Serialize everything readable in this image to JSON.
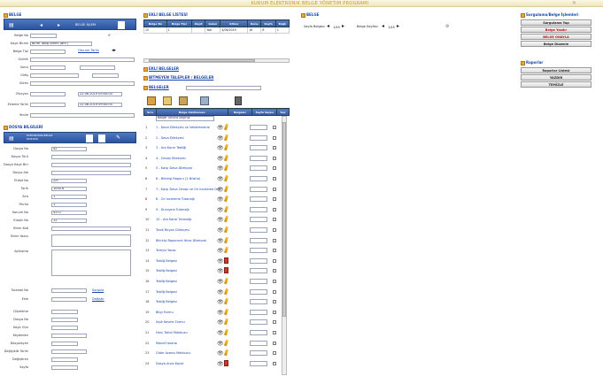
{
  "title": "KURUM ELEKTRONIK BELGE YÖNETIM PROGRAMI",
  "belge": {
    "head": "BELGE",
    "btn_belge": "BELGE İŞLEM",
    "labels": [
      "Belge No",
      "Kayıt Birimi",
      "Belge Tipi",
      "Gizlilik",
      "Konu",
      "Gidiş",
      "Sürev",
      "Ekleyen",
      "Ekleme Tarihi"
    ],
    "values": [
      "",
      "Birim Takip Birimi (BRT)",
      "",
      "",
      "Oturum Tarihi",
      "",
      "",
      "",
      ""
    ],
    "kayit_tarihi": "22.06.2019 09:00:00",
    "gelis_tarihi": "22.06.2019 09:00:00",
    "yenile": "Yenile"
  },
  "ekli": {
    "head": "EKLİ BELGE LİSTESİ",
    "cols": [
      "Belge No",
      "Belge Tipi",
      "Kayıt",
      "Gelen",
      "Gitme",
      "Konu",
      "Sayfa",
      "Bağlı"
    ],
    "row": [
      "15",
      "1",
      "",
      "Yazı",
      "4/06/2019",
      "16",
      "8",
      "1"
    ]
  },
  "links": {
    "ekli_belgeler": "EKLİ BELGELER",
    "ilgili": "BİTMEYEN TALEPLER / BELGELER",
    "belgeler": "BELGELER"
  },
  "dosya": {
    "head": "DOSYA BİLGİLERİ",
    "btn": "ELEKTRONIK BELGE DOSYASI",
    "labels": [
      "Dosya No",
      "Dosya Türü",
      "Dosya Kayıt Birimi",
      "Dosya Adı",
      "Etiket No",
      "Tarih",
      "Sıra",
      "Fihrist",
      "Konum No",
      "Klasör No",
      "Birim Kod",
      "Birim Yazısı",
      "Açıklama",
      "Tutanak No",
      "Ekle",
      "Düzeltme",
      "Dosya No",
      "Kayıt Gün",
      "Kaydeden",
      "Dosyalayan",
      "Değişiklik Tarihi",
      "Değiştiren",
      "Sayfa"
    ],
    "vals": [
      "42",
      "",
      "",
      "",
      "2/9",
      "1000.8",
      "1",
      "1",
      "4372",
      "12",
      "",
      "",
      "",
      "",
      "",
      "",
      "",
      "",
      "",
      "",
      "",
      "",
      ""
    ],
    "sorgula": "Sorgula",
    "degistir": "Değiştir"
  },
  "doc_header": {
    "cols": [
      "Sıra",
      "Belge Adı/Konusu",
      "Belgeler",
      "Sayfa Sayısı",
      "Seç"
    ],
    "filter": "Belge Türünü Seçiniz"
  },
  "docs": [
    {
      "n": "1",
      "name": "1 - Dava Dilekçesi ve Vekaletname",
      "icon": "pen"
    },
    {
      "n": "2",
      "name": "2 - Dava Dilekçesi",
      "icon": "pen"
    },
    {
      "n": "3",
      "name": "3 - Ara Karar Tebliği",
      "icon": "pen"
    },
    {
      "n": "4",
      "name": "4 - Cevap Dilekçesi",
      "icon": "pen"
    },
    {
      "n": "5",
      "name": "5 - Karşı Dava Dilekçesi",
      "icon": "pen"
    },
    {
      "n": "6",
      "name": "6 - Bilirkişi Raporu (2 Nüsha)",
      "icon": "pen"
    },
    {
      "n": "7",
      "name": "7 - Karşı Dava Cevap ve Ön İnceleme Dilekçesi",
      "icon": "pen"
    },
    {
      "n": "8",
      "name": "8 - Ön İnceleme Tutanağı",
      "icon": "pen"
    },
    {
      "n": "9",
      "name": "9 - Duruşma Tutanağı",
      "icon": "pen"
    },
    {
      "n": "10",
      "name": "10 - Ara Karar Tutanağı",
      "icon": "pen"
    },
    {
      "n": "11",
      "name": "Tanık Beyan Dilekçesi",
      "icon": "pen"
    },
    {
      "n": "12",
      "name": "Bilirkişi Raporuna İtiraz Dilekçesi",
      "icon": "pen"
    },
    {
      "n": "13",
      "name": "Temyiz Yazısı",
      "icon": "pen"
    },
    {
      "n": "14",
      "name": "Tebliğ Belgesi",
      "icon": "pdf"
    },
    {
      "n": "15",
      "name": "Tebliğ Belgesi",
      "icon": "pdf"
    },
    {
      "n": "16",
      "name": "Tebliğ Belgesi",
      "icon": "pen"
    },
    {
      "n": "17",
      "name": "Tebliğ Belgesi",
      "icon": "pen"
    },
    {
      "n": "18",
      "name": "Tebliğ Belgesi",
      "icon": "pen"
    },
    {
      "n": "19",
      "name": "Bilgi Formu",
      "icon": "pen"
    },
    {
      "n": "20",
      "name": "İlişik Kesme Formu",
      "icon": "pen"
    },
    {
      "n": "21",
      "name": "Harç Tahsil Makbuzu",
      "icon": "pen"
    },
    {
      "n": "22",
      "name": "Masraf Avansı",
      "icon": "pen"
    },
    {
      "n": "23",
      "name": "Gider Avansı Makbuzu",
      "icon": "pen"
    },
    {
      "n": "24",
      "name": "Dosya Arşiv Kaydı",
      "icon": "pdf"
    }
  ],
  "belgeler_head": "BELGE",
  "pager": {
    "label1": "Sayfa Belgesi",
    "val1": "1/45",
    "label2": "Belge Sayfası",
    "val2": "1/45"
  },
  "right": {
    "head1": "Sorgulama/Belge İşlemleri",
    "buttons1": [
      "Sorgulama Yap",
      "Belge Yazdır",
      "BELGE ONAYLA",
      "Belge Düzenle"
    ],
    "head2": "Raporlar",
    "buttons2": [
      "Raporlar Listesi",
      "YAZDIR",
      "TEMİZLE"
    ]
  }
}
